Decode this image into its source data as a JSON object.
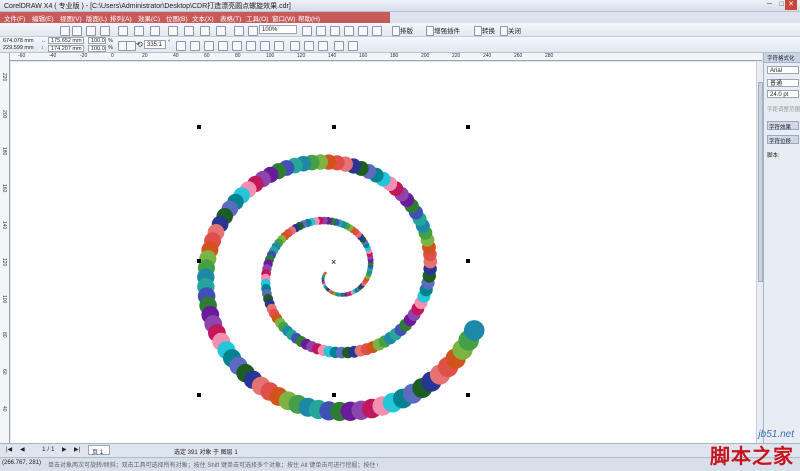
{
  "window": {
    "title": "CorelDRAW X4 ( 专业版 ) - [C:\\Users\\Administrator\\Desktop\\CDR打造漂亮圆点螺旋效果.cdr]"
  },
  "menu": [
    "文件(F)",
    "编辑(E)",
    "视图(V)",
    "版面(L)",
    "排列(A)",
    "效果(C)",
    "位图(B)",
    "文本(X)",
    "表格(T)",
    "工具(O)",
    "窗口(W)",
    "帮助(H)"
  ],
  "toolbar": {
    "zoom": "100%",
    "launch_label": "启动",
    "btn_layout": "排版",
    "btn_plugin": "增强插件",
    "btn_convert": "转换",
    "btn_close": "关闭"
  },
  "propbar": {
    "x": "674.078 mm",
    "y": "229.599 mm",
    "w": "175.652 mm",
    "h": "174.207 mm",
    "sx": "100.0",
    "sy": "100.0",
    "unit": "%",
    "angle": "335.1",
    "angle_unit": "°"
  },
  "ruler_top": [
    "-60",
    "-40",
    "-20",
    "0",
    "20",
    "40",
    "60",
    "80",
    "100",
    "120",
    "140",
    "160",
    "180",
    "200",
    "220",
    "240",
    "260",
    "280"
  ],
  "ruler_left": [
    "220",
    "200",
    "180",
    "160",
    "140",
    "120",
    "100",
    "80",
    "60",
    "40"
  ],
  "docker": {
    "title": "字符格式化",
    "font": "Arial",
    "style": "普通",
    "size": "24.0 pt",
    "range_label": "字距调整范围",
    "effects": "字符效果",
    "shift": "字符位移",
    "script": "脚本:"
  },
  "pages": {
    "counter": "1 / 1",
    "tab": "页 1"
  },
  "status": {
    "center": "选定 391 对象 于 图层 1",
    "coords": "(266.767, 281)",
    "hint": "单击对象两次可旋转/倾斜；双击工具可选择所有对象；按住 Shift 键单击可选择多个对象；按住 Alt 键单击可进行挖掘；按住 Ctrl 并单..."
  },
  "watermark": {
    "url": "jb51.net",
    "name": "脚本之家"
  },
  "colors": {
    "menu_bg": "#c85a5a",
    "palette": [
      "#e0504a",
      "#d2541c",
      "#7cb342",
      "#43a047",
      "#1e88a8",
      "#26a69a",
      "#3f51b5",
      "#2e7d32",
      "#6a1b9a",
      "#8e44ad",
      "#c2185b",
      "#f48fb1",
      "#26c6da",
      "#00838f",
      "#5c6bc0",
      "#1b5e20",
      "#283593",
      "#e57373"
    ]
  }
}
